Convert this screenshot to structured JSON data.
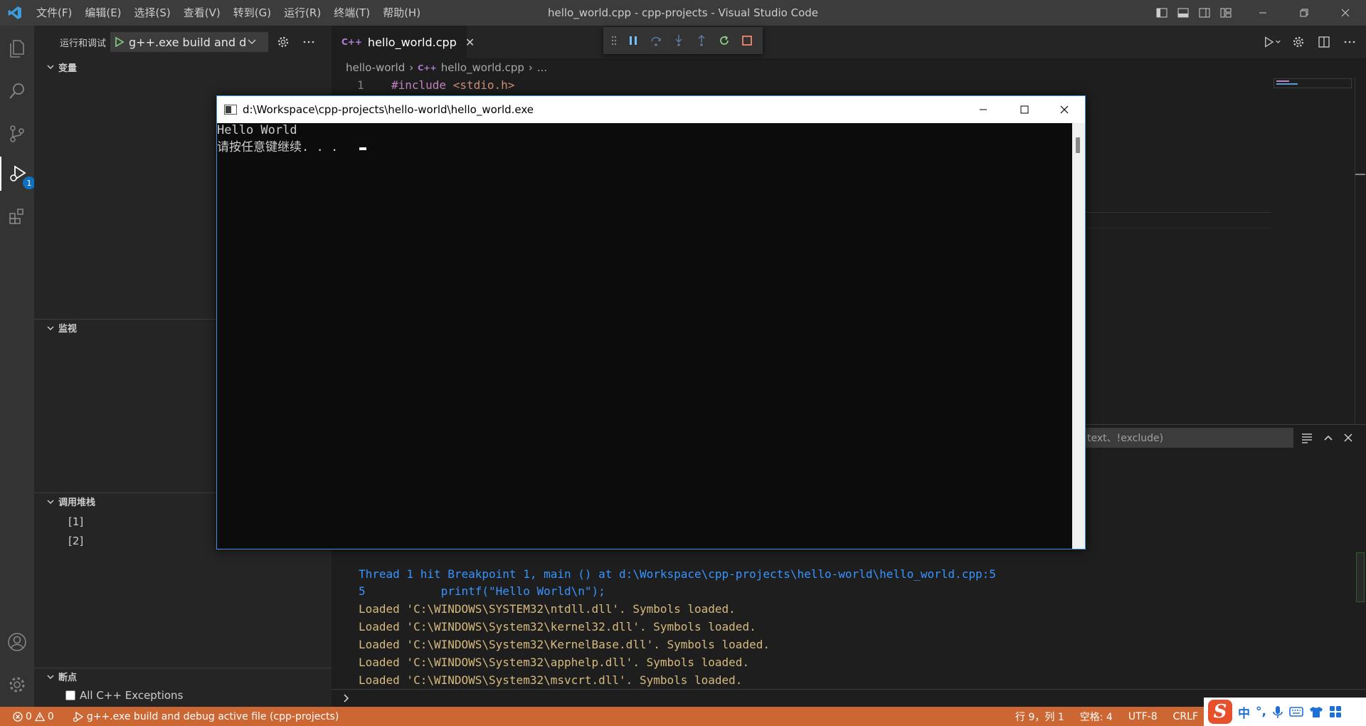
{
  "window": {
    "title": "hello_world.cpp - cpp-projects - Visual Studio Code",
    "menu": [
      "文件(F)",
      "编辑(E)",
      "选择(S)",
      "查看(V)",
      "转到(G)",
      "运行(R)",
      "终端(T)",
      "帮助(H)"
    ]
  },
  "activity": {
    "debug_badge": "1"
  },
  "sidebar": {
    "title": "运行和调试",
    "config": "g++.exe build and debug active file",
    "sections": {
      "variables": "变量",
      "watch": "监视",
      "callstack": "调用堆栈",
      "breakpoints": "断点"
    },
    "callstack_items": [
      "[1]",
      "[2]"
    ],
    "breakpoint_items": [
      "All C++ Exceptions"
    ]
  },
  "editor": {
    "tab_label": "hello_world.cpp",
    "tab_icon": "C++",
    "breadcrumb": [
      "hello-world",
      "hello_world.cpp",
      "..."
    ],
    "line_number": "1",
    "code_keyword": "#include",
    "code_rest": " <stdio.h>"
  },
  "panel": {
    "filter_placeholder": "text、!exclude)",
    "output_lines": [
      {
        "text": "Thread 1 hit Breakpoint 1, main () at d:\\Workspace\\cpp-projects\\hello-world\\hello_world.cpp:5",
        "color": "#3794ff"
      },
      {
        "text": "5\t    printf(\"Hello World\\n\");",
        "color": "#3794ff"
      },
      {
        "text": "Loaded 'C:\\WINDOWS\\SYSTEM32\\ntdll.dll'. Symbols loaded.",
        "color": "#d7ba7d"
      },
      {
        "text": "Loaded 'C:\\WINDOWS\\System32\\kernel32.dll'. Symbols loaded.",
        "color": "#d7ba7d"
      },
      {
        "text": "Loaded 'C:\\WINDOWS\\System32\\KernelBase.dll'. Symbols loaded.",
        "color": "#d7ba7d"
      },
      {
        "text": "Loaded 'C:\\WINDOWS\\System32\\apphelp.dll'. Symbols loaded.",
        "color": "#d7ba7d"
      },
      {
        "text": "Loaded 'C:\\WINDOWS\\System32\\msvcrt.dll'. Symbols loaded.",
        "color": "#d7ba7d"
      }
    ]
  },
  "console": {
    "title": "d:\\Workspace\\cpp-projects\\hello-world\\hello_world.exe",
    "lines": [
      "Hello World",
      "请按任意键继续. . ."
    ]
  },
  "statusbar": {
    "errors": "0",
    "warnings": "0",
    "launch": "g++.exe build and debug active file (cpp-projects)",
    "position": "行 9，列 1",
    "spaces": "空格: 4",
    "encoding": "UTF-8",
    "eol": "CRLF",
    "color": "#cc6633"
  },
  "ime": {
    "logo": "S",
    "lang": "中",
    "punct": "°,"
  }
}
